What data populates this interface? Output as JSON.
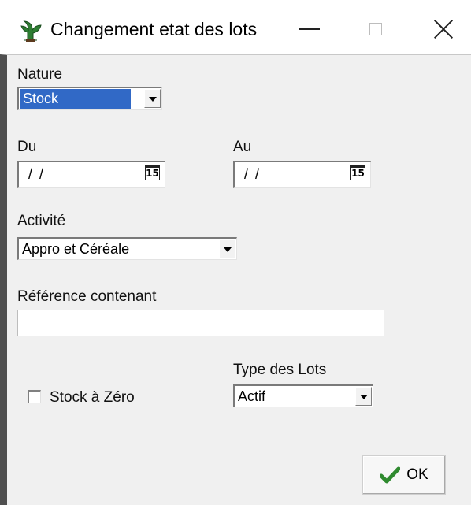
{
  "window": {
    "title": "Changement etat des lots",
    "controls": [
      "minimize-icon",
      "maximize-icon",
      "close-icon"
    ]
  },
  "form": {
    "nature": {
      "label": "Nature",
      "value": "Stock"
    },
    "du": {
      "label": "Du",
      "value": "/ /"
    },
    "au": {
      "label": "Au",
      "value": "/ /"
    },
    "activite": {
      "label": "Activité",
      "value": "Appro et Céréale"
    },
    "reference": {
      "label": "Référence contenant",
      "value": ""
    },
    "stock_zero": {
      "label": "Stock à Zéro",
      "checked": false
    },
    "type_lots": {
      "label": "Type des Lots",
      "value": "Actif"
    }
  },
  "footer": {
    "ok_label": "OK"
  },
  "colors": {
    "selection": "#3169c6",
    "ok_check": "#2f8a2f",
    "app_icon": "#2e7d32"
  }
}
